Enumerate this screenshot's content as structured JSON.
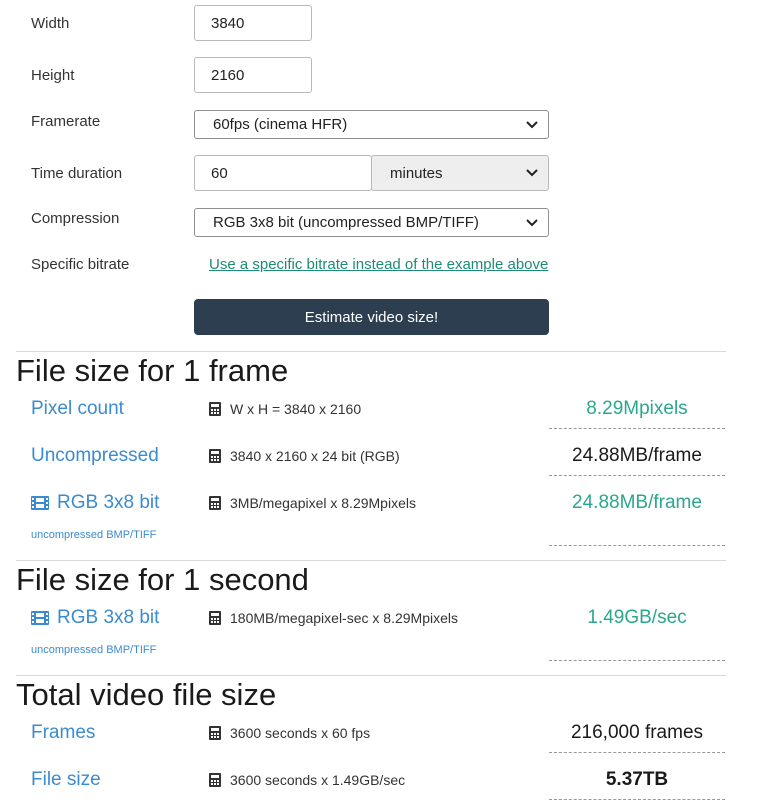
{
  "form": {
    "width": {
      "label": "Width",
      "value": "3840"
    },
    "height": {
      "label": "Height",
      "value": "2160"
    },
    "framerate": {
      "label": "Framerate",
      "selected": "60fps (cinema HFR)"
    },
    "duration": {
      "label": "Time duration",
      "value": "60",
      "unit": "minutes"
    },
    "compression": {
      "label": "Compression",
      "selected": "RGB 3x8 bit (uncompressed BMP/TIFF)"
    },
    "bitrate": {
      "label": "Specific bitrate",
      "link": "Use a specific bitrate instead of the example above"
    },
    "submit": "Estimate video size!"
  },
  "frame_section": {
    "title": "File size for 1 frame",
    "rows": [
      {
        "label": "Pixel count",
        "formula": "W x H = 3840 x 2160",
        "result": "8.29Mpixels"
      },
      {
        "label": "Uncompressed",
        "formula": "3840 x 2160 x 24 bit (RGB)",
        "result": "24.88MB/frame"
      },
      {
        "label": "RGB 3x8 bit",
        "sub": "uncompressed BMP/TIFF",
        "formula": "3MB/megapixel x 8.29Mpixels",
        "result": "24.88MB/frame"
      }
    ]
  },
  "second_section": {
    "title": "File size for 1 second",
    "rows": [
      {
        "label": "RGB 3x8 bit",
        "sub": "uncompressed BMP/TIFF",
        "formula": "180MB/megapixel-sec x 8.29Mpixels",
        "result": "1.49GB/sec"
      }
    ]
  },
  "total_section": {
    "title": "Total video file size",
    "rows": [
      {
        "label": "Frames",
        "formula": "3600 seconds x 60 fps",
        "result": "216,000 frames"
      },
      {
        "label": "File size",
        "formula": "3600 seconds x 1.49GB/sec",
        "result": "5.37TB"
      }
    ]
  },
  "icons": {
    "calculator": "calculator-icon",
    "film": "film-icon",
    "chevron": "chevron-down-icon"
  },
  "colors": {
    "accent_green": "#2aa88b",
    "link_blue": "#3b8bd0",
    "button_bg": "#2c3e50"
  }
}
